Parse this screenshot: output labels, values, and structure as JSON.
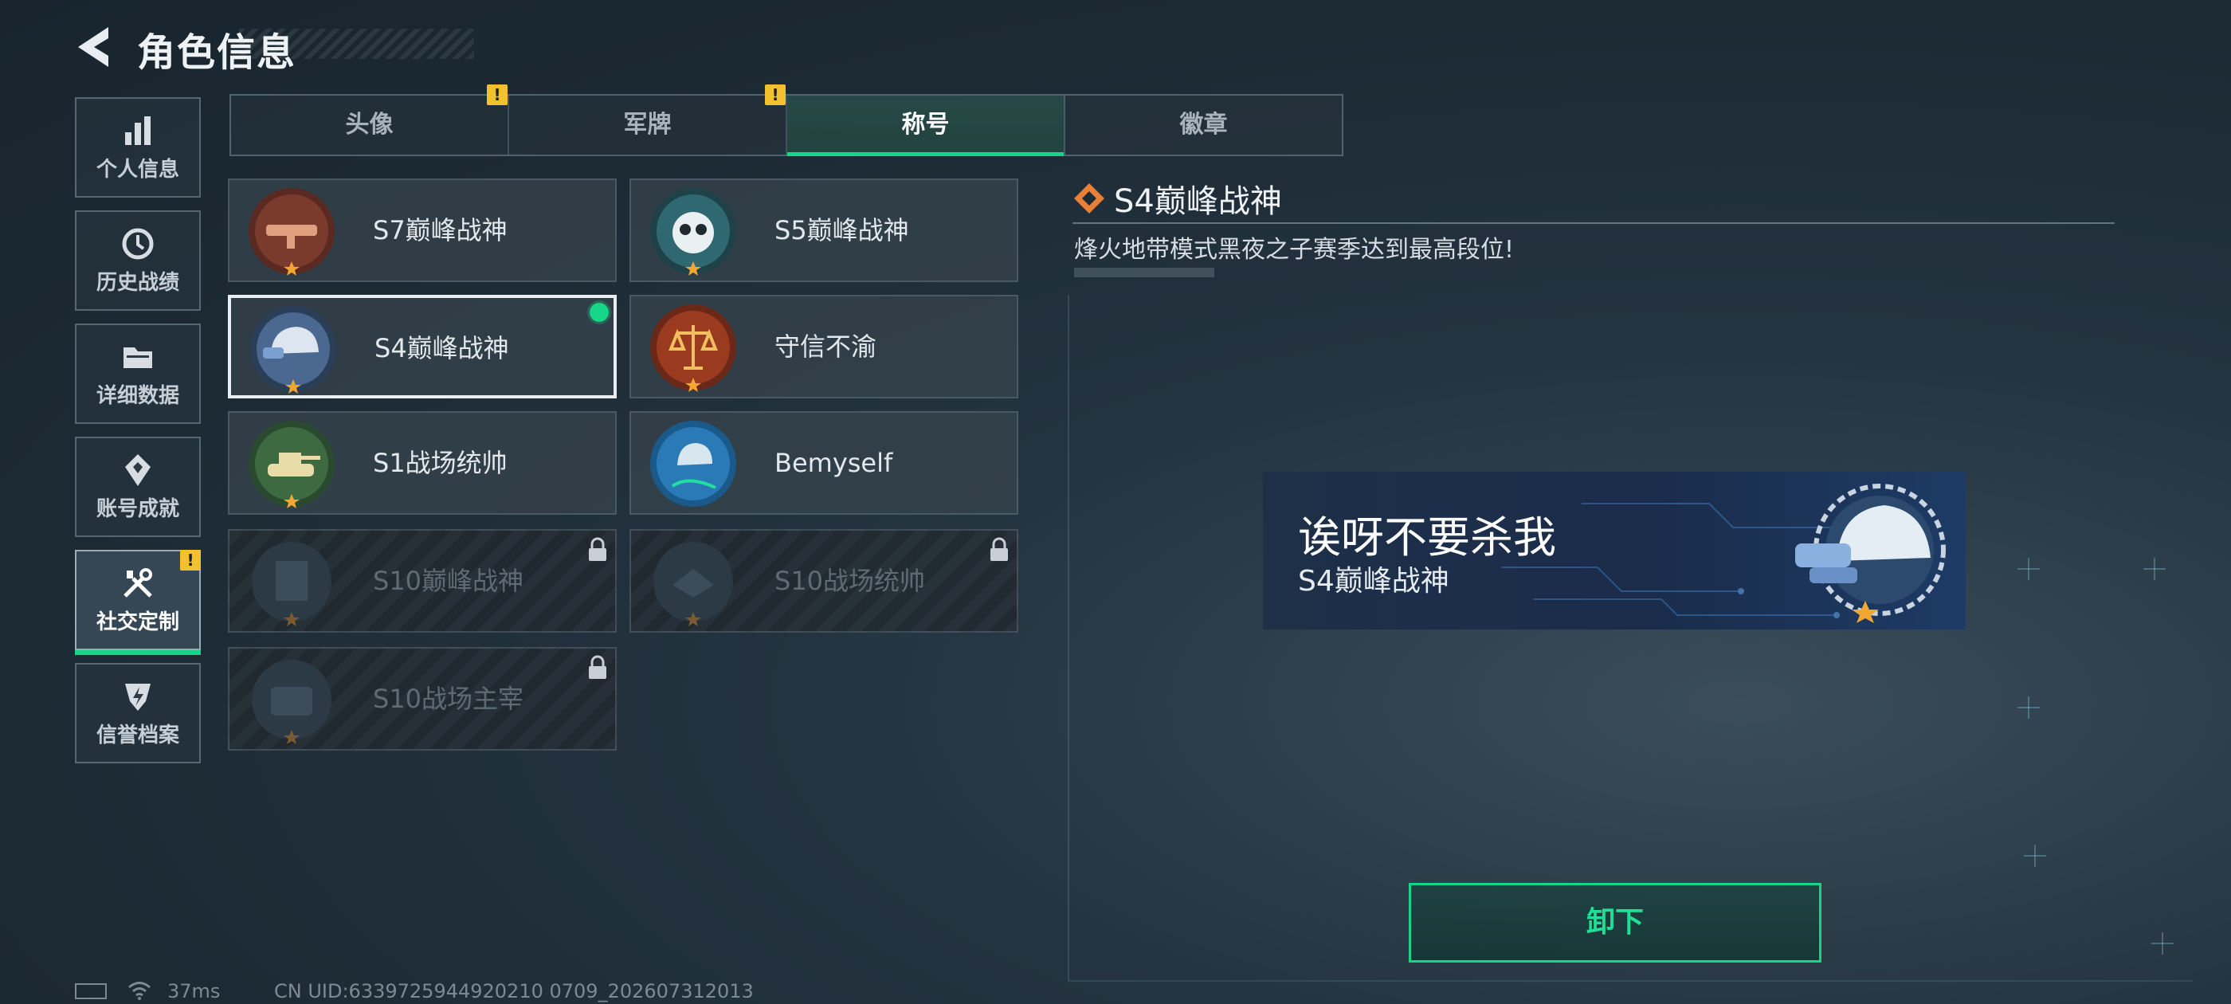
{
  "header": {
    "title": "角色信息"
  },
  "sidebar": {
    "items": [
      {
        "label": "个人信息",
        "icon": "bar-chart-icon"
      },
      {
        "label": "历史战绩",
        "icon": "history-icon"
      },
      {
        "label": "详细数据",
        "icon": "folder-icon"
      },
      {
        "label": "账号成就",
        "icon": "achievement-icon"
      },
      {
        "label": "社交定制",
        "icon": "tools-icon",
        "active": true,
        "alert": "!"
      },
      {
        "label": "信誉档案",
        "icon": "shield-icon"
      }
    ]
  },
  "tabs": [
    {
      "label": "头像",
      "alert": "!"
    },
    {
      "label": "军牌",
      "alert": "!"
    },
    {
      "label": "称号",
      "active": true
    },
    {
      "label": "徽章"
    }
  ],
  "titles": [
    {
      "name": "S7巅峰战神",
      "locked": false
    },
    {
      "name": "S5巅峰战神",
      "locked": false
    },
    {
      "name": "S4巅峰战神",
      "locked": false,
      "selected": true,
      "equipped": true
    },
    {
      "name": "守信不渝",
      "locked": false
    },
    {
      "name": "S1战场统帅",
      "locked": false
    },
    {
      "name": "Bemyself",
      "locked": false
    },
    {
      "name": "S10巅峰战神",
      "locked": true
    },
    {
      "name": "S10战场统帅",
      "locked": true
    },
    {
      "name": "S10战场主宰",
      "locked": true
    }
  ],
  "detail": {
    "title": "S4巅峰战神",
    "description": "烽火地带模式黑夜之子赛季达到最高段位!"
  },
  "preview": {
    "nickname": "诶呀不要杀我",
    "title": "S4巅峰战神"
  },
  "actions": {
    "unload_label": "卸下"
  },
  "status": {
    "ping": "37ms",
    "uid": "CN UID:6339725944920210 0709_202607312013"
  },
  "colors": {
    "accent": "#16d488",
    "alert": "#f2c12e"
  }
}
